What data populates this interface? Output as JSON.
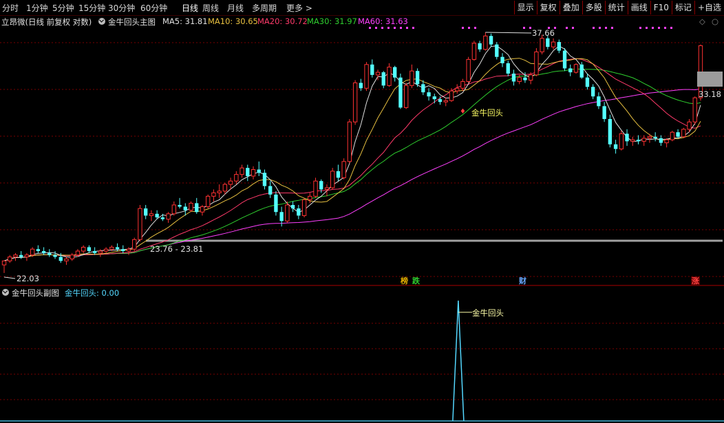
{
  "timeframes": [
    {
      "label": "分时",
      "active": false
    },
    {
      "label": "1分钟",
      "active": false
    },
    {
      "label": "5分钟",
      "active": false
    },
    {
      "label": "15分钟",
      "active": false
    },
    {
      "label": "30分钟",
      "active": false
    },
    {
      "label": "60分钟",
      "active": false
    },
    {
      "label": "日线",
      "active": true
    },
    {
      "label": "周线",
      "active": false
    },
    {
      "label": "月线",
      "active": false
    },
    {
      "label": "多周期",
      "active": false
    },
    {
      "label": "更多",
      "active": false
    }
  ],
  "tools": [
    "显示",
    "复权",
    "叠加",
    "多股",
    "统计",
    "画线",
    "F10",
    "标记",
    "+自选"
  ],
  "stock_title": "立昂微(日线 前复权 对数)",
  "main_indicator_name": "金牛回头主图",
  "ma_legend": [
    {
      "label": "MA5: 31.81",
      "color": "#e0e0e0"
    },
    {
      "label": "MA10: 30.65",
      "color": "#e8c040"
    },
    {
      "label": "MA20: 30.72",
      "color": "#ff3a6a"
    },
    {
      "label": "MA30: 31.97",
      "color": "#2fcf2f"
    },
    {
      "label": "MA60: 31.63",
      "color": "#ff40ff"
    }
  ],
  "price_labels": {
    "high": "37.66",
    "low": "22.03",
    "current": "33.18",
    "range": "23.76 - 23.81"
  },
  "signal_label": "金牛回头",
  "event_badges": [
    {
      "text": "榜",
      "color": "#e8b000"
    },
    {
      "text": "跌",
      "color": "#2fcf2f"
    },
    {
      "text": "财",
      "color": "#6aa8ff"
    },
    {
      "text": "涨",
      "color": "#ff4040"
    }
  ],
  "sub_indicator_name": "金牛回头副图",
  "sub_value_label": "金牛回头: 0.00",
  "sub_signal_label": "金牛回头",
  "colors": {
    "up": "#ff3232",
    "down": "#54ffff",
    "ma5": "#e0e0e0",
    "ma10": "#e8c040",
    "ma20": "#ff3a6a",
    "ma30": "#2fcf2f",
    "ma60": "#ff40ff",
    "grid": "#7a0000"
  },
  "chart_data": {
    "type": "candlestick",
    "candles": [
      [
        22.4,
        22.6,
        22.0,
        22.6
      ],
      [
        22.6,
        22.9,
        22.5,
        22.8
      ],
      [
        22.8,
        23.0,
        22.6,
        22.9
      ],
      [
        22.9,
        23.1,
        22.7,
        22.8
      ],
      [
        22.8,
        23.0,
        22.6,
        22.9
      ],
      [
        22.9,
        23.3,
        22.8,
        23.2
      ],
      [
        23.2,
        23.4,
        23.0,
        23.1
      ],
      [
        23.1,
        23.3,
        22.9,
        23.0
      ],
      [
        23.0,
        23.2,
        22.8,
        22.9
      ],
      [
        22.9,
        23.1,
        22.7,
        22.8
      ],
      [
        22.8,
        23.0,
        22.5,
        22.6
      ],
      [
        22.6,
        22.8,
        22.4,
        22.7
      ],
      [
        22.7,
        23.0,
        22.6,
        22.9
      ],
      [
        22.9,
        23.2,
        22.8,
        23.1
      ],
      [
        23.1,
        23.4,
        23.0,
        23.3
      ],
      [
        23.3,
        23.4,
        23.0,
        23.1
      ],
      [
        23.1,
        23.3,
        22.9,
        23.0
      ],
      [
        23.0,
        23.2,
        22.8,
        23.1
      ],
      [
        23.1,
        23.3,
        23.0,
        23.2
      ],
      [
        23.2,
        23.4,
        23.1,
        23.3
      ],
      [
        23.3,
        23.5,
        23.1,
        23.2
      ],
      [
        23.2,
        23.4,
        23.0,
        23.1
      ],
      [
        23.1,
        23.3,
        22.9,
        23.2
      ],
      [
        23.2,
        23.8,
        23.1,
        23.7
      ],
      [
        23.7,
        25.6,
        23.6,
        25.4
      ],
      [
        25.4,
        25.6,
        24.8,
        25.0
      ],
      [
        25.0,
        25.3,
        24.7,
        25.1
      ],
      [
        25.1,
        25.3,
        24.8,
        24.9
      ],
      [
        24.9,
        25.1,
        24.7,
        24.8
      ],
      [
        24.8,
        25.2,
        24.6,
        25.1
      ],
      [
        25.1,
        25.8,
        25.0,
        25.6
      ],
      [
        25.6,
        26.0,
        25.4,
        25.5
      ],
      [
        25.5,
        25.7,
        25.0,
        25.3
      ],
      [
        25.3,
        25.8,
        25.2,
        25.7
      ],
      [
        25.7,
        26.0,
        25.1,
        25.2
      ],
      [
        25.2,
        25.6,
        25.0,
        25.5
      ],
      [
        25.5,
        26.2,
        25.4,
        26.1
      ],
      [
        26.1,
        26.5,
        25.8,
        26.3
      ],
      [
        26.3,
        26.8,
        26.0,
        26.4
      ],
      [
        26.4,
        26.9,
        26.2,
        26.8
      ],
      [
        26.8,
        27.2,
        26.5,
        27.0
      ],
      [
        27.0,
        27.6,
        26.8,
        27.4
      ],
      [
        27.4,
        28.0,
        27.2,
        27.8
      ],
      [
        27.8,
        28.0,
        27.0,
        27.3
      ],
      [
        27.3,
        27.9,
        27.1,
        27.7
      ],
      [
        27.7,
        28.2,
        27.3,
        27.5
      ],
      [
        27.5,
        27.7,
        26.5,
        26.7
      ],
      [
        26.7,
        27.0,
        26.0,
        26.2
      ],
      [
        26.2,
        26.4,
        25.0,
        25.2
      ],
      [
        25.2,
        25.5,
        24.4,
        24.7
      ],
      [
        24.7,
        25.8,
        24.6,
        25.6
      ],
      [
        25.6,
        25.8,
        25.2,
        25.4
      ],
      [
        25.4,
        25.6,
        24.8,
        25.0
      ],
      [
        25.0,
        26.0,
        24.9,
        25.9
      ],
      [
        25.9,
        26.3,
        25.7,
        26.1
      ],
      [
        26.1,
        27.2,
        26.0,
        27.0
      ],
      [
        27.0,
        27.1,
        26.3,
        26.5
      ],
      [
        26.5,
        26.8,
        26.1,
        26.6
      ],
      [
        26.6,
        27.8,
        26.5,
        27.6
      ],
      [
        27.6,
        28.0,
        27.0,
        27.2
      ],
      [
        27.2,
        28.4,
        27.1,
        28.2
      ],
      [
        28.2,
        31.0,
        28.1,
        30.8
      ],
      [
        30.8,
        33.8,
        30.6,
        33.6
      ],
      [
        33.6,
        33.9,
        33.0,
        33.2
      ],
      [
        33.2,
        35.2,
        33.0,
        35.0
      ],
      [
        35.0,
        35.4,
        34.0,
        34.2
      ],
      [
        34.2,
        34.6,
        33.8,
        34.4
      ],
      [
        34.4,
        34.5,
        33.2,
        33.4
      ],
      [
        33.4,
        35.1,
        33.3,
        34.8
      ],
      [
        34.8,
        34.9,
        33.7,
        34.0
      ],
      [
        34.0,
        34.3,
        31.7,
        31.8
      ],
      [
        31.8,
        33.6,
        31.7,
        33.4
      ],
      [
        33.4,
        35.0,
        33.2,
        34.5
      ],
      [
        34.5,
        34.7,
        33.3,
        33.5
      ],
      [
        33.5,
        33.8,
        32.7,
        32.9
      ],
      [
        32.9,
        33.2,
        32.3,
        32.6
      ],
      [
        32.6,
        32.8,
        32.1,
        32.4
      ],
      [
        32.4,
        32.6,
        32.0,
        32.2
      ],
      [
        32.2,
        32.5,
        31.9,
        32.3
      ],
      [
        32.3,
        33.2,
        32.2,
        33.0
      ],
      [
        33.0,
        33.5,
        32.8,
        33.2
      ],
      [
        33.2,
        33.9,
        33.0,
        33.7
      ],
      [
        33.7,
        35.6,
        33.6,
        35.4
      ],
      [
        35.4,
        36.9,
        35.3,
        36.7
      ],
      [
        36.7,
        36.9,
        36.0,
        36.2
      ],
      [
        36.2,
        37.6,
        36.1,
        37.3
      ],
      [
        37.3,
        37.5,
        36.4,
        36.6
      ],
      [
        36.6,
        36.8,
        35.4,
        35.6
      ],
      [
        35.6,
        35.9,
        34.8,
        35.1
      ],
      [
        35.1,
        35.3,
        34.1,
        34.3
      ],
      [
        34.3,
        34.6,
        33.4,
        33.7
      ],
      [
        33.7,
        34.2,
        33.5,
        34.0
      ],
      [
        34.0,
        34.4,
        33.6,
        33.8
      ],
      [
        33.8,
        34.4,
        33.5,
        34.2
      ],
      [
        34.2,
        36.3,
        34.1,
        36.0
      ],
      [
        36.0,
        37.4,
        35.8,
        37.1
      ],
      [
        37.1,
        37.3,
        36.2,
        36.4
      ],
      [
        36.4,
        37.1,
        36.2,
        36.8
      ],
      [
        36.8,
        37.0,
        35.9,
        36.1
      ],
      [
        36.1,
        36.3,
        34.5,
        34.7
      ],
      [
        34.7,
        35.0,
        34.1,
        34.4
      ],
      [
        34.4,
        35.1,
        34.3,
        35.0
      ],
      [
        35.0,
        35.2,
        33.9,
        34.0
      ],
      [
        34.0,
        34.3,
        33.1,
        33.3
      ],
      [
        33.3,
        33.5,
        32.4,
        32.6
      ],
      [
        32.6,
        32.9,
        31.7,
        31.9
      ],
      [
        31.9,
        32.2,
        30.8,
        31.0
      ],
      [
        31.0,
        31.3,
        29.1,
        29.3
      ],
      [
        29.3,
        29.6,
        28.7,
        29.0
      ],
      [
        29.0,
        30.2,
        28.9,
        30.0
      ],
      [
        30.0,
        30.3,
        29.2,
        29.5
      ],
      [
        29.5,
        29.8,
        29.2,
        29.6
      ],
      [
        29.6,
        29.9,
        29.3,
        29.5
      ],
      [
        29.5,
        29.9,
        29.2,
        29.7
      ],
      [
        29.7,
        30.0,
        29.4,
        29.8
      ],
      [
        29.8,
        30.1,
        29.5,
        29.7
      ],
      [
        29.7,
        29.9,
        29.2,
        29.4
      ],
      [
        29.4,
        29.7,
        29.1,
        29.6
      ],
      [
        29.6,
        30.2,
        29.5,
        30.1
      ],
      [
        30.1,
        30.3,
        29.7,
        29.8
      ],
      [
        29.8,
        30.4,
        29.7,
        30.3
      ],
      [
        30.3,
        31.0,
        30.1,
        30.8
      ],
      [
        30.8,
        32.6,
        30.6,
        32.5
      ],
      [
        32.5,
        36.6,
        32.3,
        36.5
      ]
    ],
    "high_value": 37.66,
    "low_value": 22.03,
    "current_value": 33.18,
    "signal_index": 83,
    "sub_series": [
      0,
      0,
      1,
      0,
      0
    ]
  }
}
